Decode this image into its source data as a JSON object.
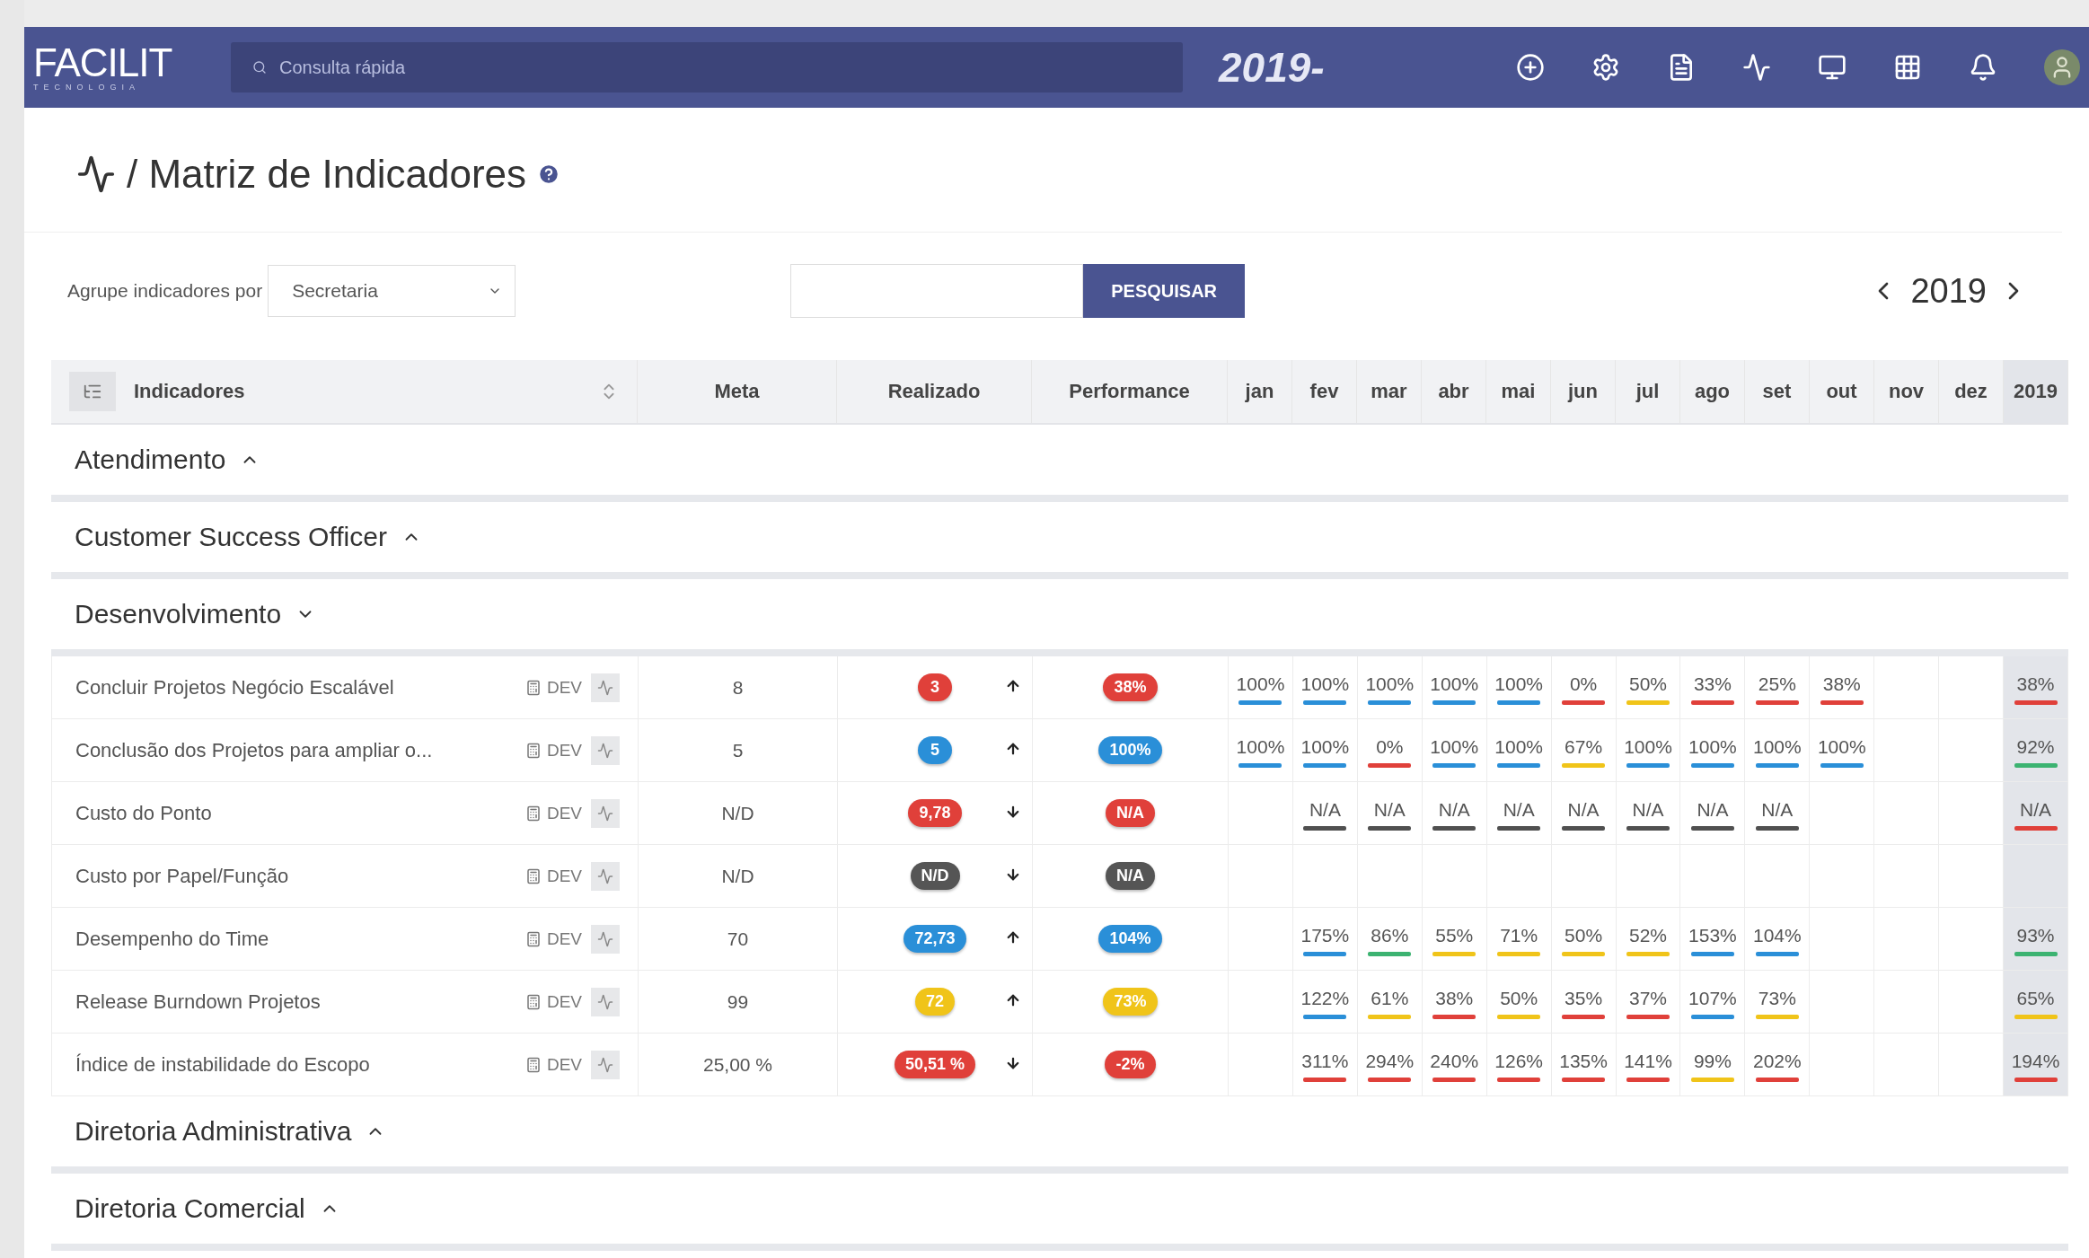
{
  "topbar": {
    "logo": "FACILIT",
    "logo_sub": "TECNOLOGIA",
    "search": {
      "placeholder": "Consulta rápida"
    },
    "year": "2019-"
  },
  "page": {
    "title": "/ Matriz de Indicadores"
  },
  "filters": {
    "group_label": "Agrupe indicadores por",
    "group_value": "Secretaria",
    "search_button": "PESQUISAR",
    "year": "2019"
  },
  "table": {
    "columns": [
      "Indicadores",
      "Meta",
      "Realizado",
      "Performance"
    ],
    "months": [
      "jan",
      "fev",
      "mar",
      "abr",
      "mai",
      "jun",
      "jul",
      "ago",
      "set",
      "out",
      "nov",
      "dez"
    ],
    "total_column": "2019",
    "groups": [
      {
        "name": "Atendimento",
        "expanded": false
      },
      {
        "name": "Customer Success Officer",
        "expanded": false
      },
      {
        "name": "Desenvolvimento",
        "expanded": true,
        "rows": [
          {
            "name": "Concluir Projetos Negócio Escalável",
            "unit": "DEV",
            "meta": "8",
            "realizado": {
              "text": "3",
              "color": "#e0403a"
            },
            "rising": true,
            "performance": {
              "text": "38%",
              "color": "#e0403a"
            },
            "months": [
              {
                "kind": "value",
                "value": "100%",
                "color": "#2a8fd8"
              },
              {
                "kind": "value",
                "value": "100%",
                "color": "#2a8fd8"
              },
              {
                "kind": "value",
                "value": "100%",
                "color": "#2a8fd8"
              },
              {
                "kind": "value",
                "value": "100%",
                "color": "#2a8fd8"
              },
              {
                "kind": "value",
                "value": "100%",
                "color": "#2a8fd8"
              },
              {
                "kind": "value",
                "value": "0%",
                "color": "#e0403a"
              },
              {
                "kind": "value",
                "value": "50%",
                "color": "#f0c419"
              },
              {
                "kind": "value",
                "value": "33%",
                "color": "#e0403a"
              },
              {
                "kind": "value",
                "value": "25%",
                "color": "#e0403a"
              },
              {
                "kind": "value",
                "value": "38%",
                "color": "#e0403a"
              },
              {
                "kind": "empty"
              },
              {
                "kind": "empty"
              }
            ],
            "total": {
              "kind": "value",
              "value": "38%",
              "color": "#e0403a"
            }
          },
          {
            "name": "Conclusão dos Projetos para ampliar o...",
            "unit": "DEV",
            "meta": "5",
            "realizado": {
              "text": "5",
              "color": "#2a8fd8"
            },
            "rising": true,
            "performance": {
              "text": "100%",
              "color": "#2a8fd8"
            },
            "months": [
              {
                "kind": "value",
                "value": "100%",
                "color": "#2a8fd8"
              },
              {
                "kind": "value",
                "value": "100%",
                "color": "#2a8fd8"
              },
              {
                "kind": "value",
                "value": "0%",
                "color": "#e0403a"
              },
              {
                "kind": "value",
                "value": "100%",
                "color": "#2a8fd8"
              },
              {
                "kind": "value",
                "value": "100%",
                "color": "#2a8fd8"
              },
              {
                "kind": "value",
                "value": "67%",
                "color": "#f0c419"
              },
              {
                "kind": "value",
                "value": "100%",
                "color": "#2a8fd8"
              },
              {
                "kind": "value",
                "value": "100%",
                "color": "#2a8fd8"
              },
              {
                "kind": "value",
                "value": "100%",
                "color": "#2a8fd8"
              },
              {
                "kind": "value",
                "value": "100%",
                "color": "#2a8fd8"
              },
              {
                "kind": "empty"
              },
              {
                "kind": "empty"
              }
            ],
            "total": {
              "kind": "value",
              "value": "92%",
              "color": "#3cb371"
            }
          },
          {
            "name": "Custo do Ponto",
            "unit": "DEV",
            "meta": "N/D",
            "realizado": {
              "text": "9,78",
              "color": "#e0403a"
            },
            "rising": false,
            "performance": {
              "text": "N/A",
              "color": "#e0403a"
            },
            "months": [
              {
                "kind": "empty"
              },
              {
                "kind": "value",
                "value": "N/A",
                "color": "#505050"
              },
              {
                "kind": "value",
                "value": "N/A",
                "color": "#505050"
              },
              {
                "kind": "value",
                "value": "N/A",
                "color": "#505050"
              },
              {
                "kind": "value",
                "value": "N/A",
                "color": "#505050"
              },
              {
                "kind": "value",
                "value": "N/A",
                "color": "#505050"
              },
              {
                "kind": "value",
                "value": "N/A",
                "color": "#505050"
              },
              {
                "kind": "value",
                "value": "N/A",
                "color": "#505050"
              },
              {
                "kind": "value",
                "value": "N/A",
                "color": "#505050"
              },
              {
                "kind": "empty"
              },
              {
                "kind": "empty"
              },
              {
                "kind": "empty"
              }
            ],
            "total": {
              "kind": "value",
              "value": "N/A",
              "color": "#e0403a"
            }
          },
          {
            "name": "Custo por Papel/Função",
            "unit": "DEV",
            "meta": "N/D",
            "realizado": {
              "text": "N/D",
              "color": "#555555"
            },
            "rising": false,
            "performance": {
              "text": "N/A",
              "color": "#555555"
            },
            "months": [
              {
                "kind": "empty"
              },
              {
                "kind": "empty"
              },
              {
                "kind": "empty"
              },
              {
                "kind": "empty"
              },
              {
                "kind": "empty"
              },
              {
                "kind": "empty"
              },
              {
                "kind": "empty"
              },
              {
                "kind": "empty"
              },
              {
                "kind": "empty"
              },
              {
                "kind": "empty"
              },
              {
                "kind": "empty"
              },
              {
                "kind": "empty"
              }
            ],
            "total": {
              "kind": "empty"
            }
          },
          {
            "name": "Desempenho do Time",
            "unit": "DEV",
            "meta": "70",
            "realizado": {
              "text": "72,73",
              "color": "#2a8fd8"
            },
            "rising": true,
            "performance": {
              "text": "104%",
              "color": "#2a8fd8"
            },
            "months": [
              {
                "kind": "empty"
              },
              {
                "kind": "value",
                "value": "175%",
                "color": "#2a8fd8"
              },
              {
                "kind": "value",
                "value": "86%",
                "color": "#3cb371"
              },
              {
                "kind": "value",
                "value": "55%",
                "color": "#f0c419"
              },
              {
                "kind": "value",
                "value": "71%",
                "color": "#f0c419"
              },
              {
                "kind": "value",
                "value": "50%",
                "color": "#f0c419"
              },
              {
                "kind": "value",
                "value": "52%",
                "color": "#f0c419"
              },
              {
                "kind": "value",
                "value": "153%",
                "color": "#2a8fd8"
              },
              {
                "kind": "value",
                "value": "104%",
                "color": "#2a8fd8"
              },
              {
                "kind": "empty"
              },
              {
                "kind": "empty"
              },
              {
                "kind": "empty"
              }
            ],
            "total": {
              "kind": "value",
              "value": "93%",
              "color": "#3cb371"
            }
          },
          {
            "name": "Release Burndown Projetos",
            "unit": "DEV",
            "meta": "99",
            "realizado": {
              "text": "72",
              "color": "#f0c419"
            },
            "rising": true,
            "performance": {
              "text": "73%",
              "color": "#f0c419"
            },
            "months": [
              {
                "kind": "empty"
              },
              {
                "kind": "value",
                "value": "122%",
                "color": "#2a8fd8"
              },
              {
                "kind": "value",
                "value": "61%",
                "color": "#f0c419"
              },
              {
                "kind": "value",
                "value": "38%",
                "color": "#e0403a"
              },
              {
                "kind": "value",
                "value": "50%",
                "color": "#f0c419"
              },
              {
                "kind": "value",
                "value": "35%",
                "color": "#e0403a"
              },
              {
                "kind": "value",
                "value": "37%",
                "color": "#e0403a"
              },
              {
                "kind": "value",
                "value": "107%",
                "color": "#2a8fd8"
              },
              {
                "kind": "value",
                "value": "73%",
                "color": "#f0c419"
              },
              {
                "kind": "empty"
              },
              {
                "kind": "empty"
              },
              {
                "kind": "empty"
              }
            ],
            "total": {
              "kind": "value",
              "value": "65%",
              "color": "#f0c419"
            }
          },
          {
            "name": "Índice de instabilidade do Escopo",
            "unit": "DEV",
            "meta": "25,00 %",
            "realizado": {
              "text": "50,51 %",
              "color": "#e0403a"
            },
            "rising": false,
            "performance": {
              "text": "-2%",
              "color": "#e0403a"
            },
            "months": [
              {
                "kind": "empty"
              },
              {
                "kind": "value",
                "value": "311%",
                "color": "#e0403a"
              },
              {
                "kind": "value",
                "value": "294%",
                "color": "#e0403a"
              },
              {
                "kind": "value",
                "value": "240%",
                "color": "#e0403a"
              },
              {
                "kind": "value",
                "value": "126%",
                "color": "#e0403a"
              },
              {
                "kind": "value",
                "value": "135%",
                "color": "#e0403a"
              },
              {
                "kind": "value",
                "value": "141%",
                "color": "#e0403a"
              },
              {
                "kind": "value",
                "value": "99%",
                "color": "#f0c419"
              },
              {
                "kind": "value",
                "value": "202%",
                "color": "#e0403a"
              },
              {
                "kind": "empty"
              },
              {
                "kind": "empty"
              },
              {
                "kind": "empty"
              }
            ],
            "total": {
              "kind": "value",
              "value": "194%",
              "color": "#e0403a"
            }
          }
        ]
      },
      {
        "name": "Diretoria Administrativa",
        "expanded": false
      },
      {
        "name": "Diretoria Comercial",
        "expanded": false
      }
    ]
  }
}
